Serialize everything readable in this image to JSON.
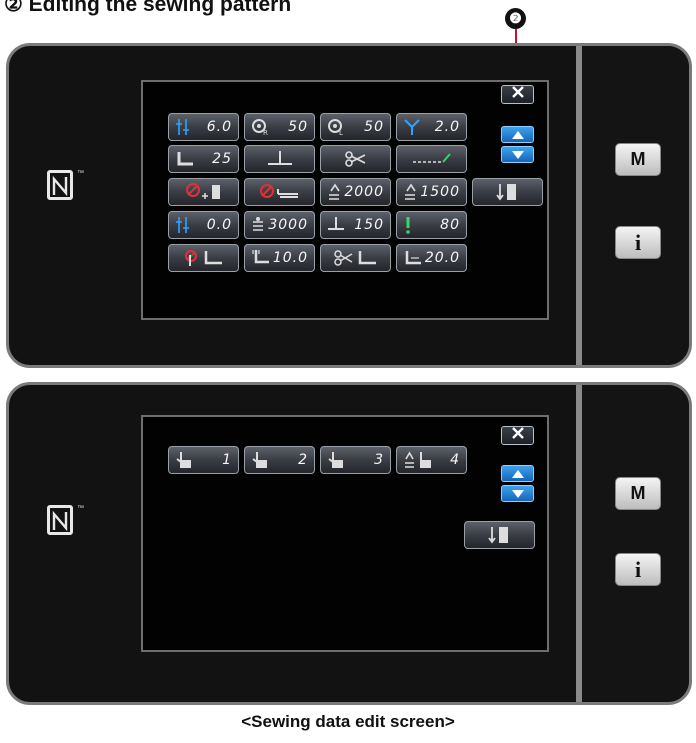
{
  "heading": "② Editing the sewing pattern",
  "callout": "❷",
  "caption": "<Sewing data edit screen>",
  "side_buttons": {
    "menu": "M",
    "info": "i"
  },
  "nfc_tm": "™",
  "top_screen": {
    "rows": [
      [
        {
          "icon": "thread-tension-icon",
          "value": "6.0"
        },
        {
          "icon": "bobbin-right-icon",
          "value": "50"
        },
        {
          "icon": "bobbin-left-icon",
          "value": "50"
        },
        {
          "icon": "presser-height-icon",
          "value": "2.0"
        }
      ],
      [
        {
          "icon": "presser-foot-icon",
          "value": "25"
        },
        {
          "icon": "needle-position-icon",
          "value": ""
        },
        {
          "icon": "scissors-icon",
          "value": ""
        },
        {
          "icon": "stitch-line-icon",
          "value": ""
        }
      ],
      [
        {
          "icon": "speed-disabled-icon",
          "value": ""
        },
        {
          "icon": "speed-cancel-icon",
          "value": ""
        },
        {
          "icon": "speed-high-icon",
          "value": "2000"
        },
        {
          "icon": "speed-low-icon",
          "value": "1500"
        },
        {
          "icon": "needle-down-icon",
          "value": ""
        }
      ],
      [
        {
          "icon": "tension-adjust-icon",
          "value": "0.0"
        },
        {
          "icon": "stitch-count-icon",
          "value": "3000"
        },
        {
          "icon": "needle-stop-icon",
          "value": "150"
        },
        {
          "icon": "alert-icon",
          "value": "80"
        }
      ],
      [
        {
          "icon": "foot-lift-disabled-icon",
          "value": ""
        },
        {
          "icon": "foot-lift-pitch-icon",
          "value": "10.0"
        },
        {
          "icon": "cut-foot-icon",
          "value": ""
        },
        {
          "icon": "foot-lift-length-icon",
          "value": "20.0"
        }
      ]
    ]
  },
  "bottom_screen": {
    "buttons": [
      {
        "icon": "hand-icon",
        "value": "1"
      },
      {
        "icon": "hand-icon",
        "value": "2"
      },
      {
        "icon": "hand-icon",
        "value": "3"
      },
      {
        "icon": "speed-hand-icon",
        "value": "4"
      }
    ]
  },
  "colors": {
    "accent_blue": "#2a8fe0",
    "callout_red": "#c8102e",
    "check_green": "#39d36b",
    "warning_red": "#e0303a"
  }
}
